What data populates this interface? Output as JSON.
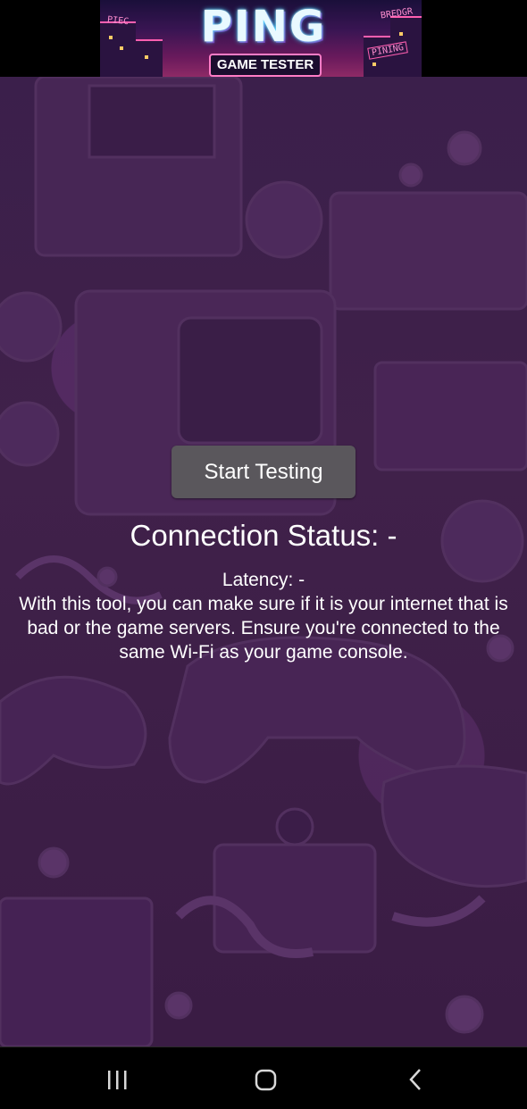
{
  "header": {
    "logo": {
      "title": "PING",
      "subtitle": "GAME TESTER",
      "sign_left": "PIEC",
      "sign_right": "BREDGR",
      "sign_right_bottom": "PINING"
    }
  },
  "main": {
    "start_button_label": "Start Testing",
    "connection_status": "Connection Status: -",
    "latency": "Latency: -",
    "description": "With this tool, you can make sure if it is your internet that is bad or the game servers. Ensure you're connected to the same Wi-Fi as your game console."
  },
  "navbar": {
    "recents_icon": "recents-icon",
    "home_icon": "home-icon",
    "back_icon": "back-icon"
  },
  "colors": {
    "button_bg": "#5a575c",
    "background": "#3b1f4b",
    "text": "#ffffff",
    "navbar": "#000000"
  }
}
